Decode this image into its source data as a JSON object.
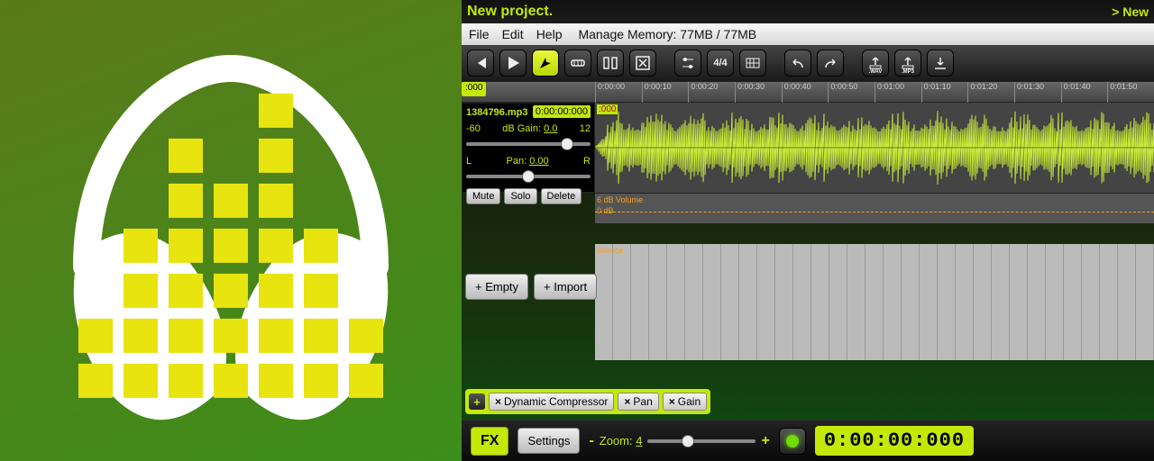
{
  "icon": {
    "eq_heights": [
      2,
      4,
      6,
      5,
      7,
      4,
      2
    ]
  },
  "title": {
    "project": "New project.",
    "news": "> New"
  },
  "menu": {
    "items": [
      "File",
      "Edit",
      "Help"
    ],
    "memory_label": "Manage Memory: 77MB / 77MB"
  },
  "toolbar": [
    {
      "name": "rewind-button",
      "icon": "rewind",
      "active": false
    },
    {
      "name": "play-button",
      "icon": "play",
      "active": false
    },
    {
      "name": "select-tool-button",
      "icon": "arrow",
      "active": true
    },
    {
      "name": "slice-tool-button",
      "icon": "slice",
      "active": false
    },
    {
      "name": "split-tool-button",
      "icon": "split",
      "active": false
    },
    {
      "name": "delete-tool-button",
      "icon": "xbox",
      "active": false
    },
    {
      "name": "automation-button",
      "icon": "sliders",
      "active": false
    },
    {
      "name": "time-signature-button",
      "icon": "timesig",
      "label": "4/4",
      "active": false
    },
    {
      "name": "grid-button",
      "icon": "grid",
      "active": false
    },
    {
      "name": "undo-button",
      "icon": "undo",
      "active": false
    },
    {
      "name": "redo-button",
      "icon": "redo",
      "active": false
    },
    {
      "name": "export-wav-button",
      "icon": "export",
      "label": ".WAV",
      "active": false
    },
    {
      "name": "export-mp3-button",
      "icon": "export",
      "label": ".MP3",
      "active": false
    },
    {
      "name": "download-button",
      "icon": "download",
      "active": false
    }
  ],
  "ruler": {
    "start_marker": ":000",
    "ticks": [
      "0:00:00",
      "0:00:10",
      "0:00:20",
      "0:00:30",
      "0:00:40",
      "0:00:50",
      "0:01:00",
      "0:01:10",
      "0:01:20",
      "0:01:30",
      "0:01:40",
      "0:01:50"
    ]
  },
  "track": {
    "name": "1384796.mp3",
    "time": "0:00:00:000",
    "clip_time_marker": ":000",
    "gain": {
      "left_label": "-60",
      "mid_label": "dB Gain:",
      "value": "0.0",
      "right_label": "12"
    },
    "pan": {
      "left_label": "L",
      "mid_label": "Pan:",
      "value": "0.00",
      "right_label": "R"
    },
    "buttons": {
      "mute": "Mute",
      "solo": "Solo",
      "delete": "Delete"
    },
    "volume_strip_label": "6 dB Volume",
    "volume_line_label": "0 dB",
    "silence_label": "Silence"
  },
  "add_row": {
    "empty": "+ Empty",
    "import": "+ Import"
  },
  "fx_chips": [
    "Dynamic Compressor",
    "Pan",
    "Gain"
  ],
  "bottom": {
    "fx_label": "FX",
    "settings_label": "Settings",
    "zoom_label": "Zoom:",
    "zoom_value": "4",
    "minus": "-",
    "plus": "+",
    "timecode": "0:00:00:000"
  }
}
